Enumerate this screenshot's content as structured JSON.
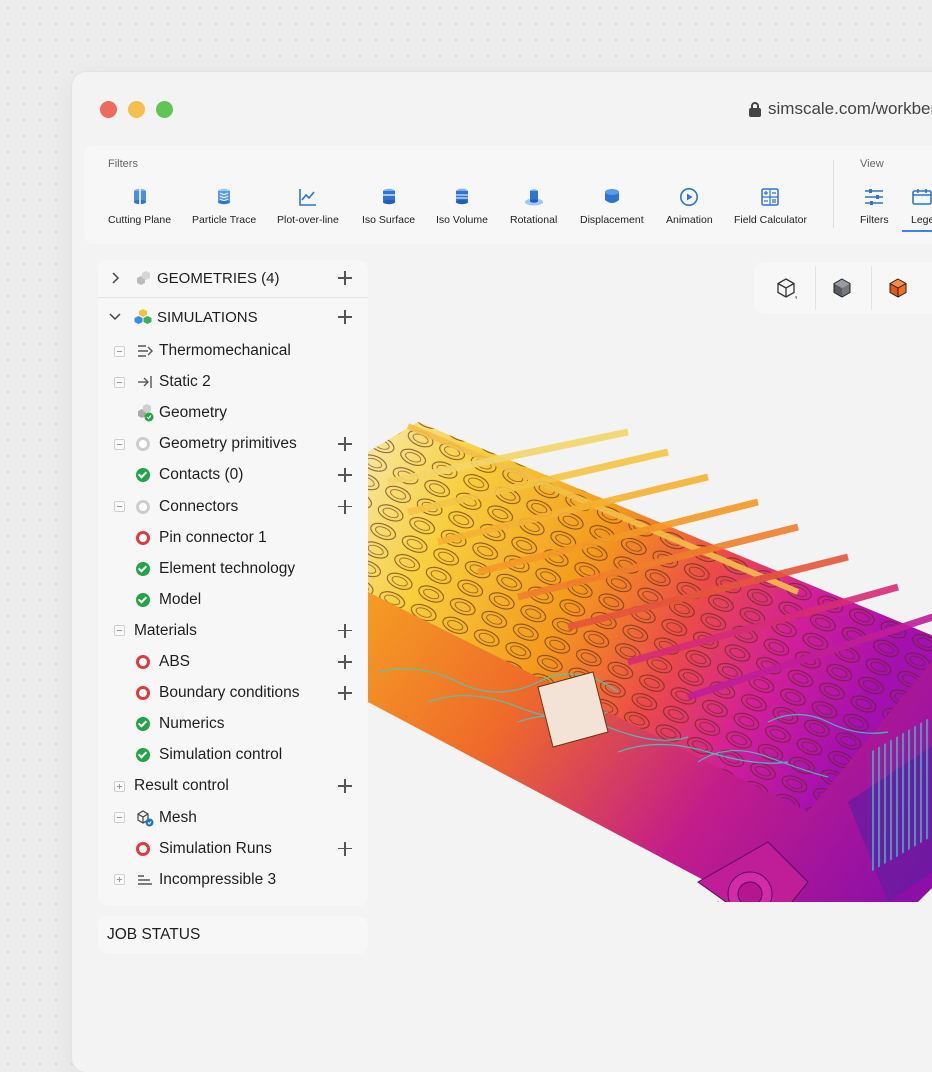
{
  "browser": {
    "url": "simscale.com/workbench"
  },
  "toolbar": {
    "filters_section": "Filters",
    "view_section": "View",
    "buttons": [
      {
        "label": "Cutting Plane",
        "icon": "cutting-plane-icon"
      },
      {
        "label": "Particle Trace",
        "icon": "particle-trace-icon"
      },
      {
        "label": "Plot-over-line",
        "icon": "plot-over-line-icon"
      },
      {
        "label": "Iso Surface",
        "icon": "iso-surface-icon"
      },
      {
        "label": "Iso Volume",
        "icon": "iso-volume-icon"
      },
      {
        "label": "Rotational",
        "icon": "rotational-icon"
      },
      {
        "label": "Displacement",
        "icon": "displacement-icon"
      },
      {
        "label": "Animation",
        "icon": "animation-icon"
      },
      {
        "label": "Field Calculator",
        "icon": "field-calculator-icon"
      }
    ],
    "view_buttons": [
      {
        "label": "Filters",
        "icon": "filters-sliders-icon"
      },
      {
        "label": "Lege",
        "icon": "legend-icon"
      }
    ]
  },
  "tree": {
    "geometries": "GEOMETRIES (4)",
    "simulations": "SIMULATIONS",
    "items": [
      {
        "label": "Thermomechanical",
        "status": "analysis-type"
      },
      {
        "label": "Static 2",
        "status": "analysis-type"
      },
      {
        "label": "Geometry",
        "status": "geometry"
      },
      {
        "label": "Geometry primitives",
        "status": "pending"
      },
      {
        "label": "Contacts (0)",
        "status": "ok"
      },
      {
        "label": "Connectors",
        "status": "pending"
      },
      {
        "label": "Pin connector 1",
        "status": "error"
      },
      {
        "label": "Element technology",
        "status": "ok"
      },
      {
        "label": "Model",
        "status": "ok"
      },
      {
        "label": "Materials",
        "status": "none"
      },
      {
        "label": "ABS",
        "status": "error"
      },
      {
        "label": "Boundary conditions",
        "status": "error"
      },
      {
        "label": "Numerics",
        "status": "ok"
      },
      {
        "label": "Simulation control",
        "status": "ok"
      },
      {
        "label": "Result control",
        "status": "none"
      },
      {
        "label": "Mesh",
        "status": "mesh"
      },
      {
        "label": "Simulation Runs",
        "status": "error"
      },
      {
        "label": "Incompressible 3",
        "status": "analysis-type"
      }
    ]
  },
  "job_status": "JOB STATUS",
  "colors": {
    "ok": "#22a447",
    "error": "#e03a3e",
    "pending": "#cdcdcd",
    "accent": "#3b82f6"
  }
}
